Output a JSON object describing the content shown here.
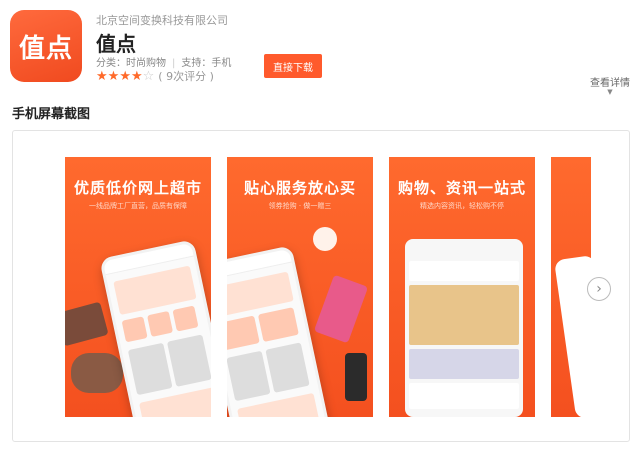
{
  "app": {
    "icon_text": "值点",
    "company": "北京空间变换科技有限公司",
    "name": "值点",
    "category_label": "分类：",
    "category_value": "时尚购物",
    "support_label": "支持：",
    "support_value": "手机",
    "rating_stars": 4,
    "rating_max": 5,
    "rating_count": "( 9次评分 )",
    "download_label": "直接下载",
    "details_label": "查看详情"
  },
  "screenshots": {
    "section_title": "手机屏幕截图",
    "items": [
      {
        "title": "优质低价网上超市",
        "subtitle": "一线品牌工厂直营，品质有保障"
      },
      {
        "title": "贴心服务放心买",
        "subtitle": "领券抢购  ·  做一赠三"
      },
      {
        "title": "购物、资讯一站式",
        "subtitle": "精选内容资讯，轻松购不停"
      }
    ],
    "next_icon": "chevron-right-icon"
  },
  "colors": {
    "accent": "#ff5a2c",
    "star": "#ff6a2a"
  }
}
